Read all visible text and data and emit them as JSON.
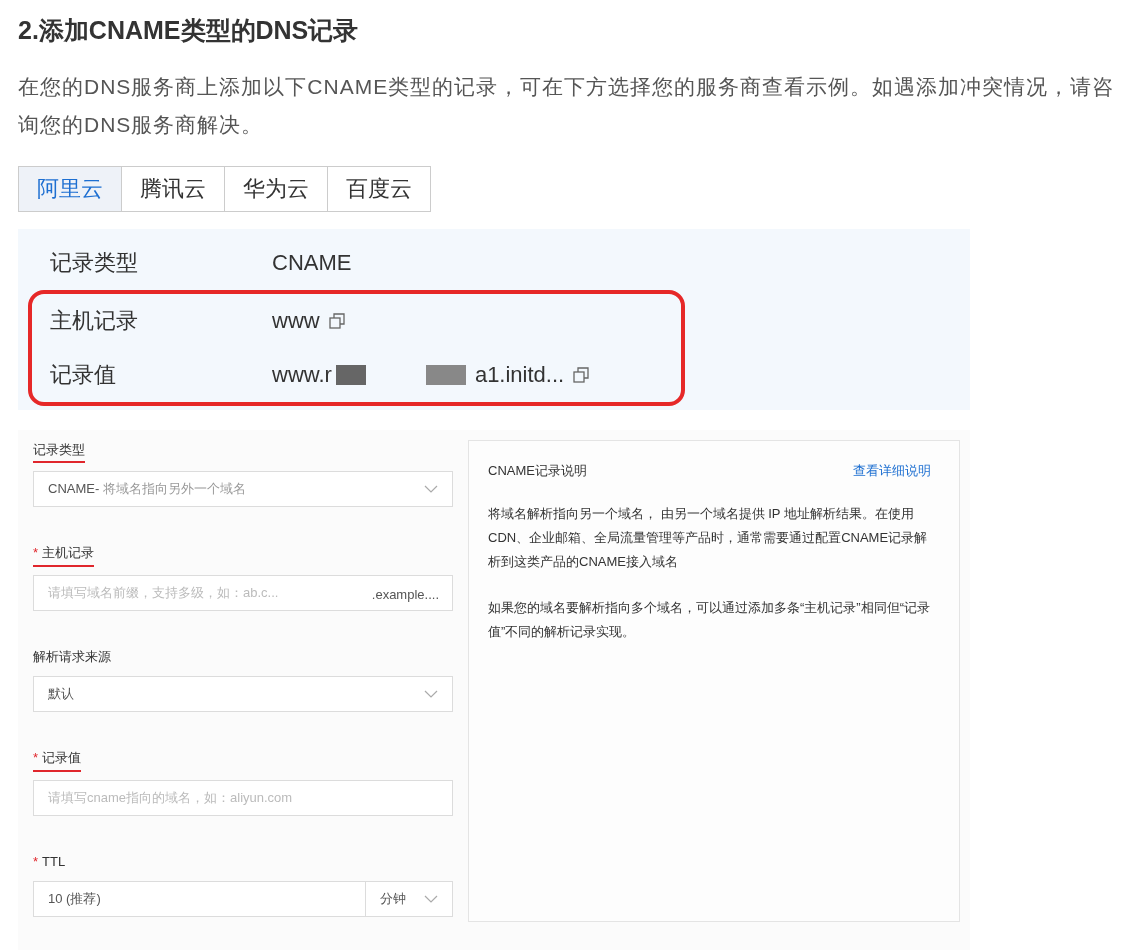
{
  "heading": "2.添加CNAME类型的DNS记录",
  "intro": "在您的DNS服务商上添加以下CNAME类型的记录，可在下方选择您的服务商查看示例。如遇添加冲突情况，请咨询您的DNS服务商解决。",
  "tabs": [
    {
      "label": "阿里云",
      "selected": true
    },
    {
      "label": "腾讯云",
      "selected": false
    },
    {
      "label": "华为云",
      "selected": false
    },
    {
      "label": "百度云",
      "selected": false
    }
  ],
  "records": [
    {
      "label": "记录类型",
      "value": "CNAME",
      "copyable": false,
      "highlighted": false
    },
    {
      "label": "主机记录",
      "value": "www",
      "copyable": true,
      "highlighted": true
    },
    {
      "label": "记录值",
      "value": "www.r",
      "value_end": "a1.initd...",
      "redacted": true,
      "copyable": true,
      "highlighted": true
    }
  ],
  "form": [
    {
      "kind": "select",
      "label": "记录类型",
      "underlined": true,
      "value": "CNAME-",
      "value_hint": " 将域名指向另外一个域名"
    },
    {
      "kind": "input",
      "label": "主机记录",
      "required_mark": "*",
      "underlined": true,
      "placeholder": "请填写域名前缀，支持多级，如：ab.c...",
      "suffix": ".example...."
    },
    {
      "kind": "select",
      "label": "解析请求来源",
      "underlined": false,
      "value": "默认"
    },
    {
      "kind": "input",
      "label": "记录值",
      "required_mark": "*",
      "underlined": true,
      "placeholder": "请填写cname指向的域名，如：aliyun.com"
    },
    {
      "kind": "ttl",
      "label": "TTL",
      "required_mark": "*",
      "underlined": false,
      "value": "10 (推荐)",
      "unit": "分钟"
    }
  ],
  "help": {
    "title": "CNAME记录说明",
    "link": "查看详细说明",
    "paragraphs": [
      "将域名解析指向另一个域名， 由另一个域名提供 IP 地址解析结果。在使用CDN、企业邮箱、全局流量管理等产品时，通常需要通过配置CNAME记录解析到这类产品的CNAME接入域名",
      "如果您的域名要解析指向多个域名，可以通过添加多条“主机记录”相同但“记录值”不同的解析记录实现。"
    ]
  }
}
